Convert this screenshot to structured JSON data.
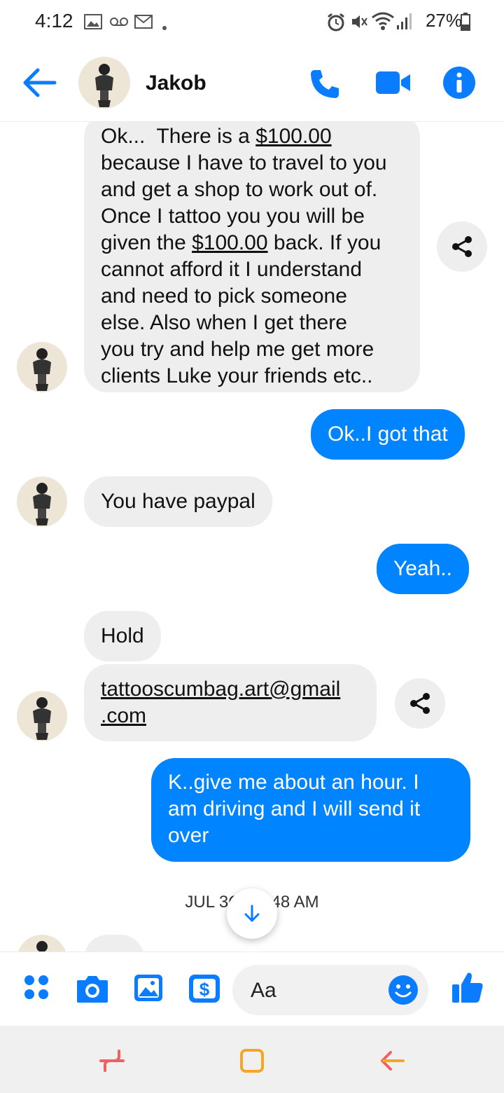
{
  "status_bar": {
    "time": "4:12",
    "battery": "27%"
  },
  "header": {
    "contact_name": "Jakob"
  },
  "messages": [
    {
      "side": "received",
      "parts": [
        "Ok...  There is a ",
        "$100.00",
        "\nbecause I have to travel to you\nand get a shop to work out of.\nOnce I tattoo you you will be\ngiven the ",
        "$100.00",
        " back. If you\ncannot afford it I understand\nand need to pick someone\nelse. Also when I get there\nyou try and help me get more\nclients Luke your friends etc.."
      ]
    },
    {
      "side": "sent",
      "text": "Ok..I got that"
    },
    {
      "side": "received",
      "text": "You have paypal"
    },
    {
      "side": "sent",
      "text": "Yeah.."
    },
    {
      "side": "received",
      "text": "Hold"
    },
    {
      "side": "received",
      "link_line1": "tattooscumbag.art@gmail",
      "link_line2": ".com"
    },
    {
      "side": "sent",
      "text": "K..give me about an hour. I\nam driving and I will send it\nover"
    }
  ],
  "timestamp": {
    "left": "JUL 3C",
    "right": "48 AM"
  },
  "composer": {
    "placeholder": "Aa"
  },
  "colors": {
    "accent": "#0084ff",
    "received_bubble": "#eeeeee",
    "nav_recents": "#f06060",
    "nav_home": "#f6a623"
  }
}
